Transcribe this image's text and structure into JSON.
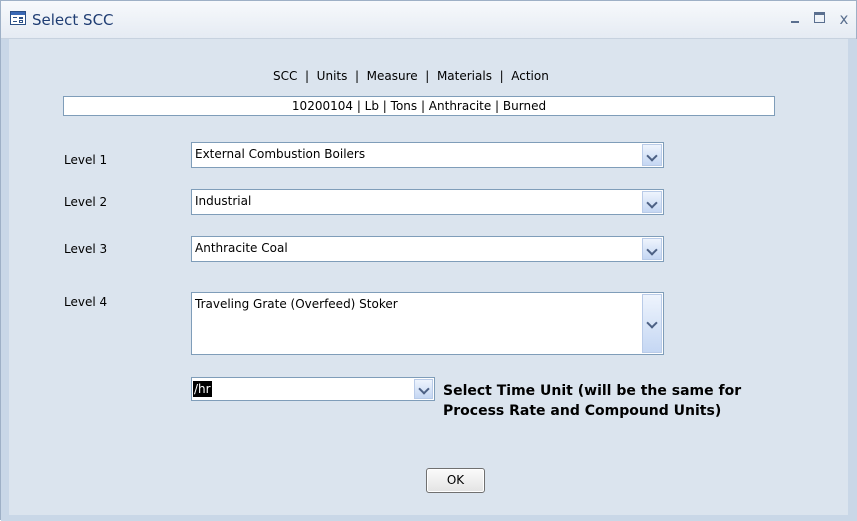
{
  "window": {
    "title": "Select SCC",
    "controls": {
      "minimize": "minimize",
      "maximize": "maximize",
      "close": "x"
    }
  },
  "header": {
    "label": "SCC  |  Units  |  Measure  |  Materials  |  Action"
  },
  "summary": {
    "value": "10200104 | Lb | Tons | Anthracite | Burned"
  },
  "levels": [
    {
      "label": "Level 1",
      "value": "External Combustion Boilers"
    },
    {
      "label": "Level 2",
      "value": "Industrial"
    },
    {
      "label": "Level 3",
      "value": "Anthracite Coal"
    },
    {
      "label": "Level 4",
      "value": "Traveling Grate (Overfeed) Stoker"
    }
  ],
  "time_unit": {
    "value": "/hr",
    "note": "Select Time Unit (will be the same for Process Rate and Compound Units)"
  },
  "ok_button": {
    "label": "OK"
  },
  "icons": {
    "window": "form-icon",
    "dropdown": "chevron-down-icon"
  },
  "colors": {
    "title_text": "#1f3d73",
    "form_background": "#dbe4ee",
    "border": "#7f9db9"
  }
}
